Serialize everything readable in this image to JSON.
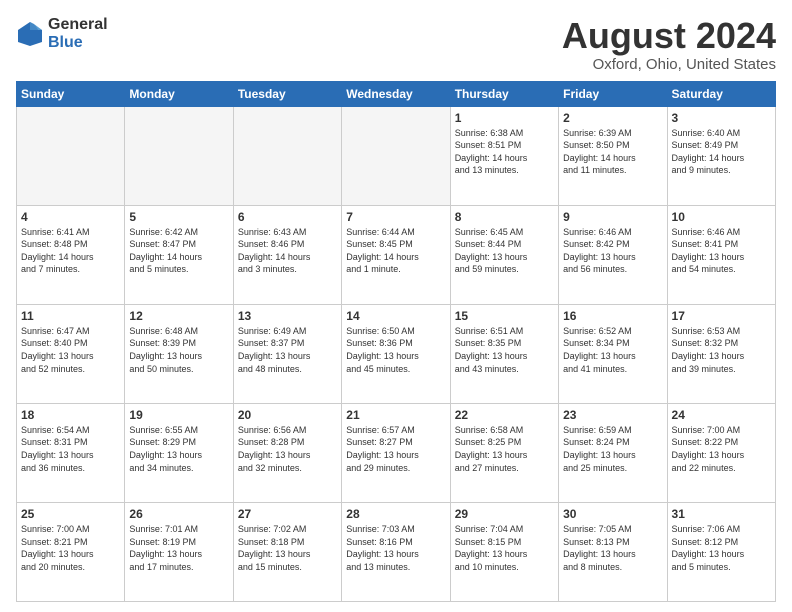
{
  "logo": {
    "general": "General",
    "blue": "Blue"
  },
  "title": {
    "month": "August 2024",
    "location": "Oxford, Ohio, United States"
  },
  "days_header": [
    "Sunday",
    "Monday",
    "Tuesday",
    "Wednesday",
    "Thursday",
    "Friday",
    "Saturday"
  ],
  "weeks": [
    [
      {
        "day": "",
        "info": ""
      },
      {
        "day": "",
        "info": ""
      },
      {
        "day": "",
        "info": ""
      },
      {
        "day": "",
        "info": ""
      },
      {
        "day": "1",
        "info": "Sunrise: 6:38 AM\nSunset: 8:51 PM\nDaylight: 14 hours\nand 13 minutes."
      },
      {
        "day": "2",
        "info": "Sunrise: 6:39 AM\nSunset: 8:50 PM\nDaylight: 14 hours\nand 11 minutes."
      },
      {
        "day": "3",
        "info": "Sunrise: 6:40 AM\nSunset: 8:49 PM\nDaylight: 14 hours\nand 9 minutes."
      }
    ],
    [
      {
        "day": "4",
        "info": "Sunrise: 6:41 AM\nSunset: 8:48 PM\nDaylight: 14 hours\nand 7 minutes."
      },
      {
        "day": "5",
        "info": "Sunrise: 6:42 AM\nSunset: 8:47 PM\nDaylight: 14 hours\nand 5 minutes."
      },
      {
        "day": "6",
        "info": "Sunrise: 6:43 AM\nSunset: 8:46 PM\nDaylight: 14 hours\nand 3 minutes."
      },
      {
        "day": "7",
        "info": "Sunrise: 6:44 AM\nSunset: 8:45 PM\nDaylight: 14 hours\nand 1 minute."
      },
      {
        "day": "8",
        "info": "Sunrise: 6:45 AM\nSunset: 8:44 PM\nDaylight: 13 hours\nand 59 minutes."
      },
      {
        "day": "9",
        "info": "Sunrise: 6:46 AM\nSunset: 8:42 PM\nDaylight: 13 hours\nand 56 minutes."
      },
      {
        "day": "10",
        "info": "Sunrise: 6:46 AM\nSunset: 8:41 PM\nDaylight: 13 hours\nand 54 minutes."
      }
    ],
    [
      {
        "day": "11",
        "info": "Sunrise: 6:47 AM\nSunset: 8:40 PM\nDaylight: 13 hours\nand 52 minutes."
      },
      {
        "day": "12",
        "info": "Sunrise: 6:48 AM\nSunset: 8:39 PM\nDaylight: 13 hours\nand 50 minutes."
      },
      {
        "day": "13",
        "info": "Sunrise: 6:49 AM\nSunset: 8:37 PM\nDaylight: 13 hours\nand 48 minutes."
      },
      {
        "day": "14",
        "info": "Sunrise: 6:50 AM\nSunset: 8:36 PM\nDaylight: 13 hours\nand 45 minutes."
      },
      {
        "day": "15",
        "info": "Sunrise: 6:51 AM\nSunset: 8:35 PM\nDaylight: 13 hours\nand 43 minutes."
      },
      {
        "day": "16",
        "info": "Sunrise: 6:52 AM\nSunset: 8:34 PM\nDaylight: 13 hours\nand 41 minutes."
      },
      {
        "day": "17",
        "info": "Sunrise: 6:53 AM\nSunset: 8:32 PM\nDaylight: 13 hours\nand 39 minutes."
      }
    ],
    [
      {
        "day": "18",
        "info": "Sunrise: 6:54 AM\nSunset: 8:31 PM\nDaylight: 13 hours\nand 36 minutes."
      },
      {
        "day": "19",
        "info": "Sunrise: 6:55 AM\nSunset: 8:29 PM\nDaylight: 13 hours\nand 34 minutes."
      },
      {
        "day": "20",
        "info": "Sunrise: 6:56 AM\nSunset: 8:28 PM\nDaylight: 13 hours\nand 32 minutes."
      },
      {
        "day": "21",
        "info": "Sunrise: 6:57 AM\nSunset: 8:27 PM\nDaylight: 13 hours\nand 29 minutes."
      },
      {
        "day": "22",
        "info": "Sunrise: 6:58 AM\nSunset: 8:25 PM\nDaylight: 13 hours\nand 27 minutes."
      },
      {
        "day": "23",
        "info": "Sunrise: 6:59 AM\nSunset: 8:24 PM\nDaylight: 13 hours\nand 25 minutes."
      },
      {
        "day": "24",
        "info": "Sunrise: 7:00 AM\nSunset: 8:22 PM\nDaylight: 13 hours\nand 22 minutes."
      }
    ],
    [
      {
        "day": "25",
        "info": "Sunrise: 7:00 AM\nSunset: 8:21 PM\nDaylight: 13 hours\nand 20 minutes."
      },
      {
        "day": "26",
        "info": "Sunrise: 7:01 AM\nSunset: 8:19 PM\nDaylight: 13 hours\nand 17 minutes."
      },
      {
        "day": "27",
        "info": "Sunrise: 7:02 AM\nSunset: 8:18 PM\nDaylight: 13 hours\nand 15 minutes."
      },
      {
        "day": "28",
        "info": "Sunrise: 7:03 AM\nSunset: 8:16 PM\nDaylight: 13 hours\nand 13 minutes."
      },
      {
        "day": "29",
        "info": "Sunrise: 7:04 AM\nSunset: 8:15 PM\nDaylight: 13 hours\nand 10 minutes."
      },
      {
        "day": "30",
        "info": "Sunrise: 7:05 AM\nSunset: 8:13 PM\nDaylight: 13 hours\nand 8 minutes."
      },
      {
        "day": "31",
        "info": "Sunrise: 7:06 AM\nSunset: 8:12 PM\nDaylight: 13 hours\nand 5 minutes."
      }
    ]
  ]
}
